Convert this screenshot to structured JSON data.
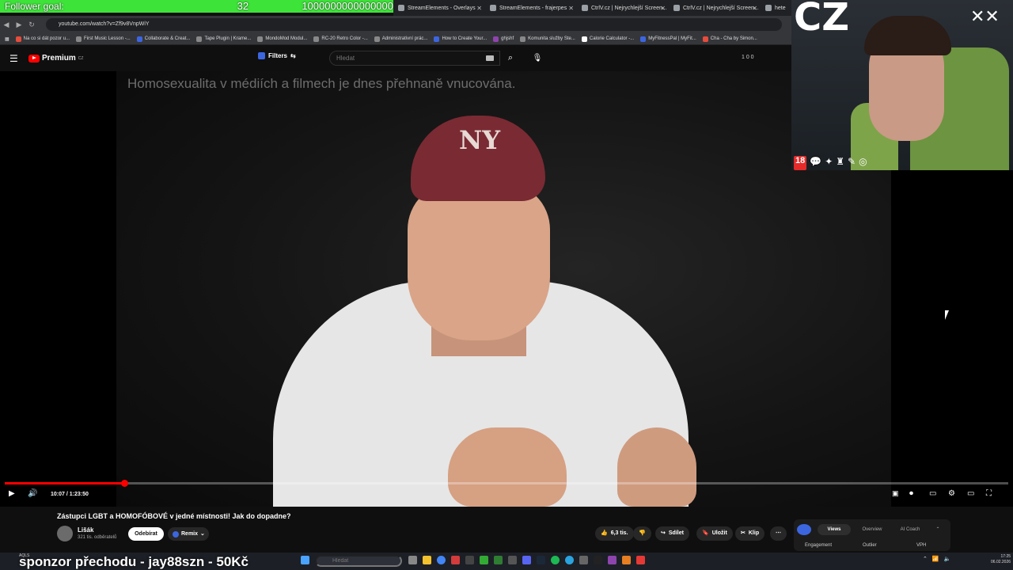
{
  "stream_overlay": {
    "follower_label": "Follower goal:",
    "follower_count": "32",
    "follower_goal": "1000000000000000",
    "sponsor_text": "sponzor přechodu - jay88szn - 50Kč",
    "webcam_label": "CZ",
    "signature_glyph": "✕✕",
    "badge_18": "18"
  },
  "browser": {
    "tabs": [
      {
        "label": "StreamElements - Overlays"
      },
      {
        "label": "StreamElements - frajerpes"
      },
      {
        "label": "CtrlV.cz | Nejrychlejší Screen..."
      },
      {
        "label": "CtrlV.cz | Nejrychlejší Screen..."
      },
      {
        "label": "heteronormativit"
      }
    ],
    "url": "youtube.com/watch?v=Zf9v8VnpWiY",
    "bookmarks": [
      "Na co si dát pozor u...",
      "First Music Lesson -...",
      "Collaborate & Creat...",
      "Tape Plugin | Krame...",
      "MondoMod Modul...",
      "RC-20 Retro Color -...",
      "Administrativní prác...",
      "How to Create Your...",
      "ghjshf",
      "Komunita služby Ste...",
      "Calorie Calculator -...",
      "MyFitnessPal | MyFit...",
      "Cha - Cha by Simon..."
    ]
  },
  "youtube_header": {
    "brand": "Premium",
    "region": "CZ",
    "filters_label": "Filters",
    "search_placeholder": "Hledat",
    "counters": "1  0  0"
  },
  "video": {
    "overlay_caption": "Homosexualita v médiích a filmech je dnes přehnaně vnucována.",
    "cap_logo": "NY",
    "time_display": "10:07 / 1:23:50",
    "progress": 0.12
  },
  "video_info": {
    "title": "Zástupci LGBT a HOMOFÓBOVÉ v jedné místnosti! Jak do dopadne?",
    "channel_name": "Lišák",
    "subscribers": "321 tis. odběratelů",
    "subscribe_label": "Odebírat",
    "remix_label": "Remix",
    "likes": "6,3 tis.",
    "share_label": "Sdílet",
    "save_label": "Uložit",
    "clip_label": "Klip"
  },
  "side_panel": {
    "tabs": [
      "Views",
      "Overview",
      "AI Coach"
    ],
    "labels": [
      "Engagement",
      "Outlier",
      "VPH"
    ]
  },
  "taskbar": {
    "search_placeholder": "Hledat",
    "aqls": "AQLS",
    "time": "17:25",
    "date": "06.02.2026"
  }
}
